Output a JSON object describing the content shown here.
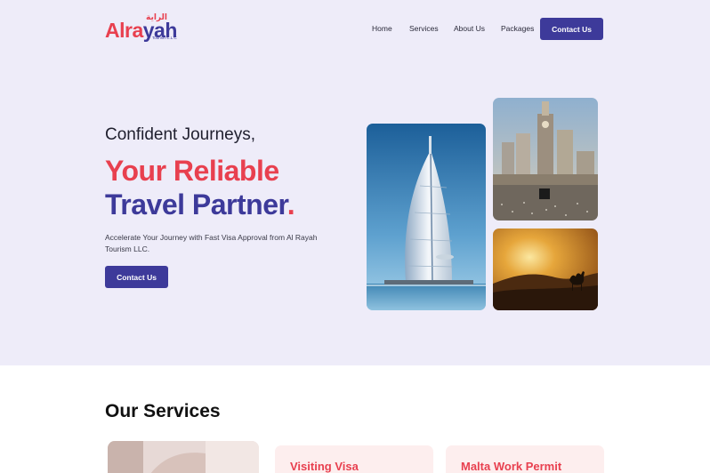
{
  "brand": {
    "name_part1": "Alra",
    "name_part2": "yah",
    "arabic": "الراية",
    "tagline": "Tourism L.L.C",
    "accent_red": "#e8404f",
    "accent_indigo": "#3d3a9a"
  },
  "nav": {
    "items": [
      "Home",
      "Services",
      "About Us",
      "Packages"
    ],
    "cta_label": "Contact Us"
  },
  "hero": {
    "pre_heading": "Confident Journeys,",
    "heading_line1": "Your Reliable",
    "heading_line2": "Travel Partner",
    "heading_dot": ".",
    "subtext": "Accelerate Your Journey with Fast Visa Approval from Al Rayah Tourism LLC.",
    "cta_label": "Contact Us",
    "images": [
      "burj-al-arab-photo",
      "makkah-clock-tower-photo",
      "desert-camel-sunset-photo"
    ]
  },
  "services": {
    "title": "Our Services",
    "cards": [
      {
        "title": "Visiting Visa"
      },
      {
        "title": "Malta Work Permit"
      }
    ]
  }
}
